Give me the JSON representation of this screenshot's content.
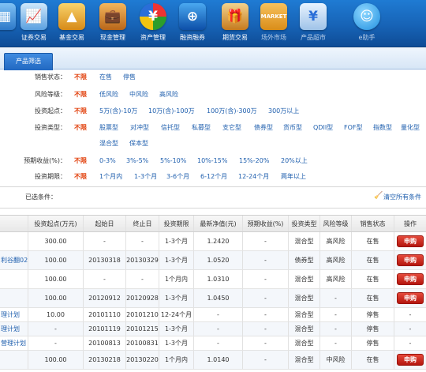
{
  "toolbar": {
    "items": [
      {
        "label": "",
        "icon": "grid-icon"
      },
      {
        "label": "证券交易",
        "icon": "stock-chart-icon"
      },
      {
        "label": "基金交易",
        "icon": "fund-pyramid-icon"
      },
      {
        "label": "现金管理",
        "icon": "briefcase-icon"
      },
      {
        "label": "资产管理",
        "icon": "pie-chart-icon"
      },
      {
        "label": "融资融券",
        "icon": "trading-icon"
      },
      {
        "label": "期货交易",
        "icon": "gift-box-icon"
      },
      {
        "label": "场外市场",
        "icon": "market-bag-icon"
      },
      {
        "label": "产品超市",
        "icon": "product-shelf-icon"
      },
      {
        "label": "e助手",
        "icon": "assistant-mascot-icon"
      }
    ]
  },
  "tabs": {
    "product_filter": "产品筛选"
  },
  "filters": {
    "rows": [
      {
        "label": "销售状态：",
        "options": [
          "不限",
          "在售",
          "停售"
        ]
      },
      {
        "label": "风险等级：",
        "options": [
          "不限",
          "低风险",
          "中风险",
          "高风险"
        ]
      },
      {
        "label": "投资起点：",
        "options": [
          "不限",
          "5万(含)-10万",
          "10万(含)-100万",
          "100万(含)-300万",
          "300万以上"
        ]
      },
      {
        "label": "投资类型：",
        "options": [
          "不限",
          "股票型",
          "对冲型",
          "信托型",
          "私募型",
          "支它型",
          "债券型",
          "货币型",
          "QDII型",
          "FOF型",
          "指数型",
          "量化型"
        ]
      },
      {
        "label": "",
        "options": [
          "混合型",
          "保本型"
        ]
      },
      {
        "label": "预期收益(%)：",
        "options": [
          "不限",
          "0-3%",
          "3%-5%",
          "5%-10%",
          "10%-15%",
          "15%-20%",
          "20%以上"
        ]
      },
      {
        "label": "投资期限：",
        "options": [
          "不限",
          "1个月内",
          "1-3个月",
          "3-6个月",
          "6-12个月",
          "12-24个月",
          "两年以上"
        ]
      }
    ],
    "selected_label": "已选条件：",
    "clear_all": "清空所有条件"
  },
  "table": {
    "columns": [
      "",
      "投资起点(万元)",
      "起始日",
      "终止日",
      "投资期限",
      "最新净值(元)",
      "预期收益(%)",
      "投资类型",
      "风险等级",
      "销售状态",
      "操作"
    ],
    "buy_label": "申购",
    "rows": [
      {
        "cells": [
          "",
          "300.00",
          "-",
          "-",
          "1-3个月",
          "1.2420",
          "-",
          "混合型",
          "高风险",
          "在售"
        ],
        "buy": true
      },
      {
        "cells": [
          "利谷翻02",
          "100.00",
          "20130318",
          "20130329",
          "1-3个月",
          "1.0520",
          "-",
          "债券型",
          "高风险",
          "在售"
        ],
        "buy": true
      },
      {
        "cells": [
          "",
          "100.00",
          "-",
          "-",
          "1个月内",
          "1.0310",
          "-",
          "混合型",
          "高风险",
          "在售"
        ],
        "buy": true
      },
      {
        "cells": [
          "",
          "100.00",
          "20120912",
          "20120928",
          "1-3个月",
          "1.0450",
          "-",
          "混合型",
          "-",
          "在售"
        ],
        "buy": true
      },
      {
        "cells": [
          "理计划",
          "10.00",
          "20101110",
          "20101210",
          "12-24个月",
          "-",
          "-",
          "混合型",
          "-",
          "停售"
        ],
        "buy": false
      },
      {
        "cells": [
          "理计划",
          "-",
          "20101119",
          "20101215",
          "1-3个月",
          "-",
          "-",
          "混合型",
          "-",
          "停售"
        ],
        "buy": false
      },
      {
        "cells": [
          "营理计划",
          "-",
          "20100813",
          "20100831",
          "1-3个月",
          "-",
          "-",
          "混合型",
          "-",
          "停售"
        ],
        "buy": false
      },
      {
        "cells": [
          "",
          "100.00",
          "20130218",
          "20130220",
          "1个月内",
          "1.0140",
          "-",
          "混合型",
          "中风险",
          "在售"
        ],
        "buy": true
      }
    ]
  }
}
